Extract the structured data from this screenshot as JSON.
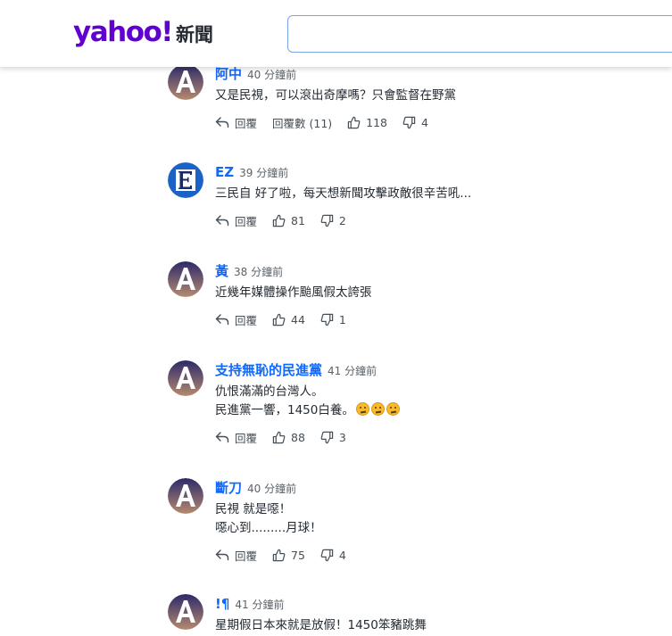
{
  "header": {
    "logo_text": "yahoo!",
    "section_text": "新聞",
    "search_placeholder": ""
  },
  "labels": {
    "reply": "回覆",
    "replies_prefix": "回覆數"
  },
  "colors": {
    "brand_purple": "#6001d2",
    "name_blue": "#0f69ff",
    "avatar_bg_top": "#2d2a6a",
    "avatar_bg_bottom": "#b58a6e",
    "avatar_e_bg": "#1a62c6"
  },
  "comments": [
    {
      "name": "阿中",
      "time": "40 分鐘前",
      "avatar": "A",
      "lines": [
        "又是民視，可以滾出奇摩嗎？只會監督在野黨"
      ],
      "replies": "回覆數 (11)",
      "likes": "118",
      "dislikes": "4"
    },
    {
      "name": "EZ",
      "time": "39 分鐘前",
      "avatar": "E",
      "lines": [
        "三民自 好了啦，每天想新聞攻擊政敵很辛苦吼..."
      ],
      "likes": "81",
      "dislikes": "2"
    },
    {
      "name": "黃",
      "time": "38 分鐘前",
      "avatar": "A",
      "lines": [
        "近幾年媒體操作颱風假太誇張"
      ],
      "likes": "44",
      "dislikes": "1"
    },
    {
      "name": "支持無恥的民進黨",
      "time": "41 分鐘前",
      "avatar": "A",
      "lines": [
        "仇恨滿滿的台灣人。",
        "民進黨一響，1450白養。"
      ],
      "emoji_count": 3,
      "likes": "88",
      "dislikes": "3"
    },
    {
      "name": "斷刀",
      "time": "40 分鐘前",
      "avatar": "A",
      "lines": [
        "民視 就是噁！",
        "噁心到.........月球！"
      ],
      "likes": "75",
      "dislikes": "4"
    },
    {
      "name": "!¶",
      "time": "41 分鐘前",
      "avatar": "A",
      "lines": [
        "星期假日本來就是放假！1450笨豬跳舞"
      ]
    }
  ]
}
